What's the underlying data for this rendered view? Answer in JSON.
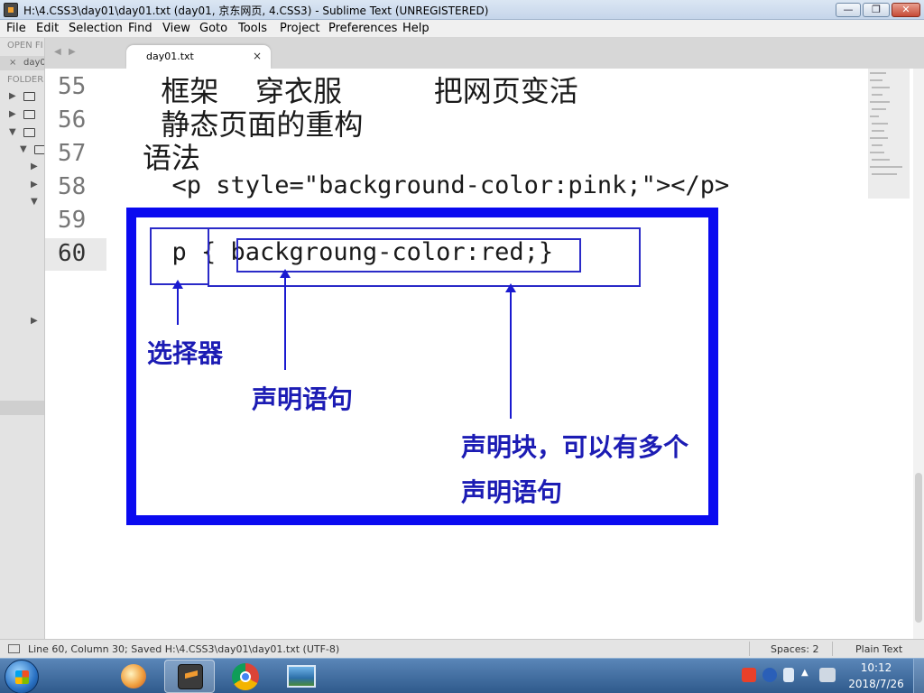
{
  "window": {
    "title": "H:\\4.CSS3\\day01\\day01.txt (day01, 京东网页, 4.CSS3) - Sublime Text (UNREGISTERED)",
    "minimize": "—",
    "maximize": "❐",
    "close": "✕"
  },
  "menu": [
    "File",
    "Edit",
    "Selection",
    "Find",
    "View",
    "Goto",
    "Tools",
    "Project",
    "Preferences",
    "Help"
  ],
  "sidebar": {
    "open_files_label": "OPEN FI",
    "open_file_name": "day0",
    "close_mark": "×",
    "folders_label": "FOLDER"
  },
  "tab": {
    "label": "day01.txt",
    "close": "×"
  },
  "editor": {
    "lines": [
      {
        "number": "55",
        "text": "  框架    穿衣服          把网页变活"
      },
      {
        "number": "56",
        "text": "  静态页面的重构"
      },
      {
        "number": "57",
        "text": "语法"
      },
      {
        "number": "58",
        "text": "  <p style=\"background-color:pink;\"></p>"
      },
      {
        "number": "59",
        "text": ""
      },
      {
        "number": "60",
        "text": "  p { backgroung-color:red;}"
      }
    ],
    "current_line": "60"
  },
  "annotation": {
    "selector_label": "选择器",
    "declaration_label": "声明语句",
    "block_label_line1": "声明块，可以有多个",
    "block_label_line2": "声明语句",
    "color": "#0a0af0"
  },
  "statusbar": {
    "position": "Line 60, Column 30; Saved H:\\4.CSS3\\day01\\day01.txt (UTF-8)",
    "indent": "Spaces: 2",
    "syntax": "Plain Text"
  },
  "taskbar": {
    "time": "10:12",
    "date": "2018/7/26"
  }
}
